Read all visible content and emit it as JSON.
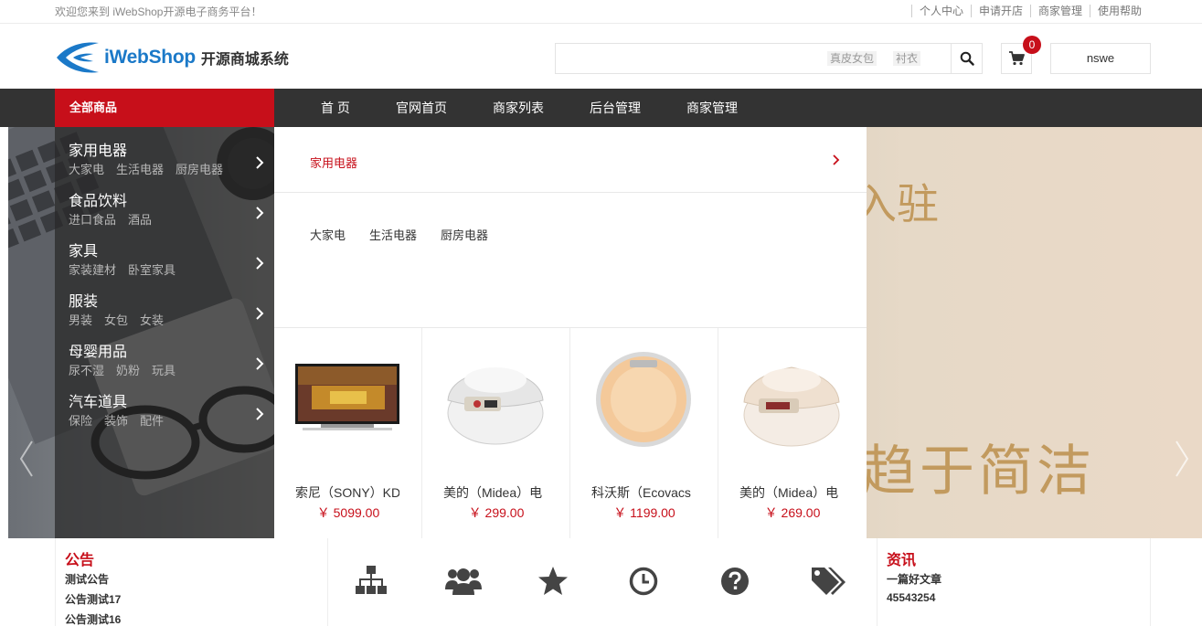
{
  "topbar": {
    "welcome": "欢迎您来到 iWebShop开源电子商务平台！",
    "links": [
      "个人中心",
      "申请开店",
      "商家管理",
      "使用帮助"
    ]
  },
  "header": {
    "logo_word": "iWebShop",
    "logo_sub": "开源商城系统",
    "search_placeholder": "",
    "hot_words": [
      "真皮女包",
      "衬衣"
    ],
    "cart_count": "0",
    "username": "nswe"
  },
  "nav": {
    "all_categories": "全部商品",
    "items": [
      "首 页",
      "官网首页",
      "商家列表",
      "后台管理",
      "商家管理"
    ]
  },
  "hero": {
    "line1": "入驻",
    "line2": "趋于简洁"
  },
  "categories": [
    {
      "title": "家用电器",
      "subs": [
        "大家电",
        "生活电器",
        "厨房电器"
      ]
    },
    {
      "title": "食品饮料",
      "subs": [
        "进口食品",
        "酒品"
      ]
    },
    {
      "title": "家具",
      "subs": [
        "家装建材",
        "卧室家具"
      ]
    },
    {
      "title": "服装",
      "subs": [
        "男装",
        "女包",
        "女装"
      ]
    },
    {
      "title": "母婴用品",
      "subs": [
        "尿不湿",
        "奶粉",
        "玩具"
      ]
    },
    {
      "title": "汽车道具",
      "subs": [
        "保险",
        "装饰",
        "配件"
      ]
    }
  ],
  "flyout": {
    "title": "家用电器",
    "subs": [
      "大家电",
      "生活电器",
      "厨房电器"
    ],
    "products": [
      {
        "name": "索尼（SONY）KD",
        "price": "￥ 5099.00",
        "icon": "tv-icon"
      },
      {
        "name": "美的（Midea）电",
        "price": "￥ 299.00",
        "icon": "rice-cooker-icon"
      },
      {
        "name": "科沃斯（Ecovacs",
        "price": "￥ 1199.00",
        "icon": "robot-vacuum-icon"
      },
      {
        "name": "美的（Midea）电",
        "price": "￥ 269.00",
        "icon": "rice-cooker-icon"
      }
    ]
  },
  "notice": {
    "title": "公告",
    "items": [
      "测试公告",
      "公告测试17",
      "公告测试16"
    ]
  },
  "news": {
    "title": "资讯",
    "items": [
      "一篇好文章",
      "45543254"
    ]
  },
  "quick_icons": [
    "sitemap-icon",
    "users-icon",
    "star-icon",
    "clock-icon",
    "question-icon",
    "tags-icon"
  ],
  "colors": {
    "brand_red": "#c70f1a",
    "nav_dark": "#333333",
    "logo_blue": "#1b79c8"
  }
}
